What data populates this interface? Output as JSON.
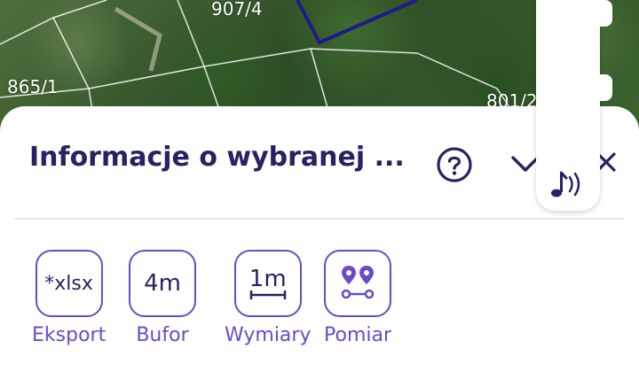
{
  "map": {
    "parcel_labels": [
      "907/4",
      "865/1",
      "801/2"
    ]
  },
  "panel": {
    "title": "Informacje o wybranej ...",
    "help_icon": "help-circle-icon",
    "collapse_icon": "chevron-down-icon",
    "close_icon": "close-icon"
  },
  "tools": [
    {
      "icon_text": "*xlsx",
      "label": "Eksport"
    },
    {
      "icon_text": "4m",
      "label": "Bufor"
    },
    {
      "icon_text": "1m",
      "label": "Wymiary"
    },
    {
      "icon_text": "",
      "label": "Pomiar"
    }
  ],
  "side_panel": {
    "icon": "audio-description-icon"
  },
  "colors": {
    "primary_text": "#262364",
    "accent": "#6b4ac4",
    "parcel_outline": "#1f1a8a"
  }
}
